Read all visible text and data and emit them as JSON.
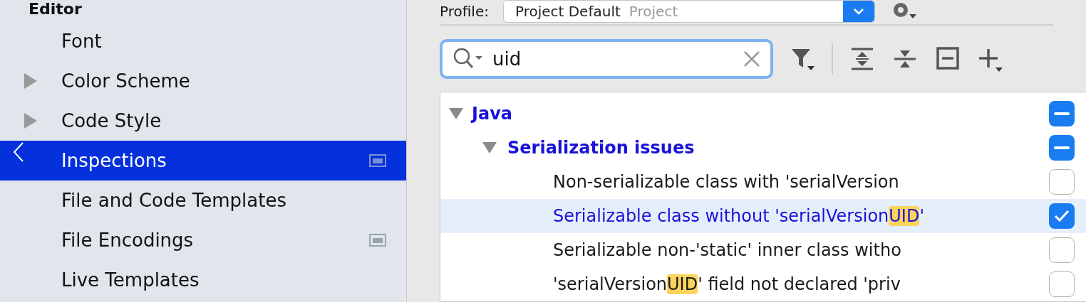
{
  "sidebar": {
    "header": "Editor",
    "items": [
      {
        "label": "Font",
        "kind": "leaf",
        "selected": false,
        "project_scope": false
      },
      {
        "label": "Color Scheme",
        "kind": "group",
        "selected": false,
        "project_scope": false
      },
      {
        "label": "Code Style",
        "kind": "group",
        "selected": false,
        "project_scope": false
      },
      {
        "label": "Inspections",
        "kind": "leaf",
        "selected": true,
        "project_scope": true
      },
      {
        "label": "File and Code Templates",
        "kind": "leaf",
        "selected": false,
        "project_scope": false
      },
      {
        "label": "File Encodings",
        "kind": "leaf",
        "selected": false,
        "project_scope": true
      },
      {
        "label": "Live Templates",
        "kind": "leaf",
        "selected": false,
        "project_scope": false
      }
    ]
  },
  "profile": {
    "label": "Profile:",
    "value": "Project Default",
    "scope": "Project"
  },
  "search": {
    "value": "uid"
  },
  "tree": [
    {
      "label": "Java",
      "expanded": true,
      "mixed": true,
      "children": [
        {
          "label": "Serialization issues",
          "expanded": true,
          "mixed": true,
          "children": [
            {
              "segments": [
                {
                  "text": "Non-serializable class with 'serialVersion",
                  "match": false
                }
              ],
              "selected": false,
              "checked": false
            },
            {
              "segments": [
                {
                  "text": "Serializable class without 'serialVersion",
                  "match": false
                },
                {
                  "text": "UID",
                  "match": true
                },
                {
                  "text": "'",
                  "match": false
                }
              ],
              "selected": true,
              "checked": true
            },
            {
              "segments": [
                {
                  "text": "Serializable non-'static' inner class witho",
                  "match": false
                }
              ],
              "selected": false,
              "checked": false
            },
            {
              "segments": [
                {
                  "text": "'serialVersion",
                  "match": false
                },
                {
                  "text": "UID",
                  "match": true
                },
                {
                  "text": "' field not declared 'priv",
                  "match": false
                }
              ],
              "selected": false,
              "checked": false
            }
          ]
        }
      ]
    }
  ]
}
